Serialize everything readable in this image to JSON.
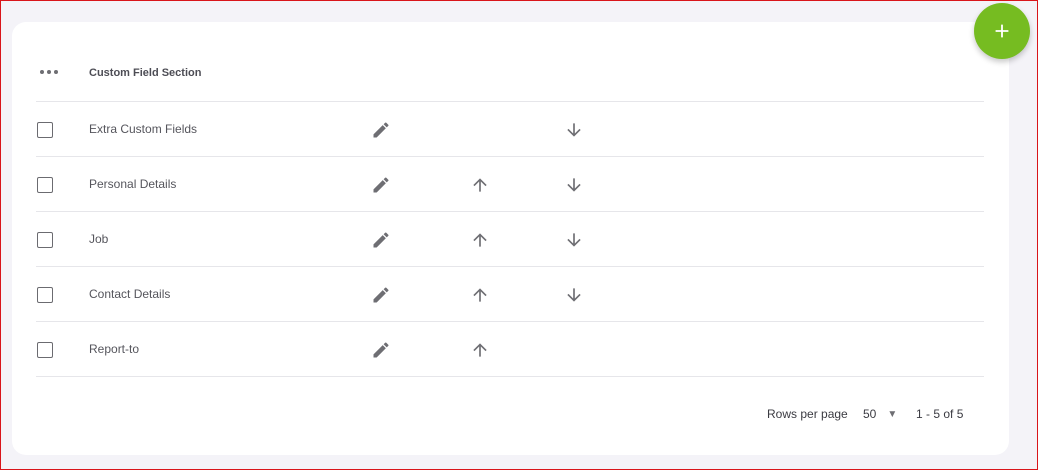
{
  "table": {
    "header": {
      "label": "Custom Field Section"
    },
    "rows": [
      {
        "name": "Extra Custom Fields",
        "can_move_up": false,
        "can_move_down": true
      },
      {
        "name": "Personal Details",
        "can_move_up": true,
        "can_move_down": true
      },
      {
        "name": "Job",
        "can_move_up": true,
        "can_move_down": true
      },
      {
        "name": "Contact Details",
        "can_move_up": true,
        "can_move_down": true
      },
      {
        "name": "Report-to",
        "can_move_up": true,
        "can_move_down": false
      }
    ]
  },
  "footer": {
    "rows_per_page_label": "Rows per page",
    "rows_per_page_value": "50",
    "range": "1 - 5 of 5"
  },
  "colors": {
    "accent": "#76bc21",
    "icon": "#6e6e73"
  },
  "icons": [
    "more-horizontal-icon",
    "pencil-icon",
    "arrow-up-icon",
    "arrow-down-icon",
    "plus-icon"
  ]
}
